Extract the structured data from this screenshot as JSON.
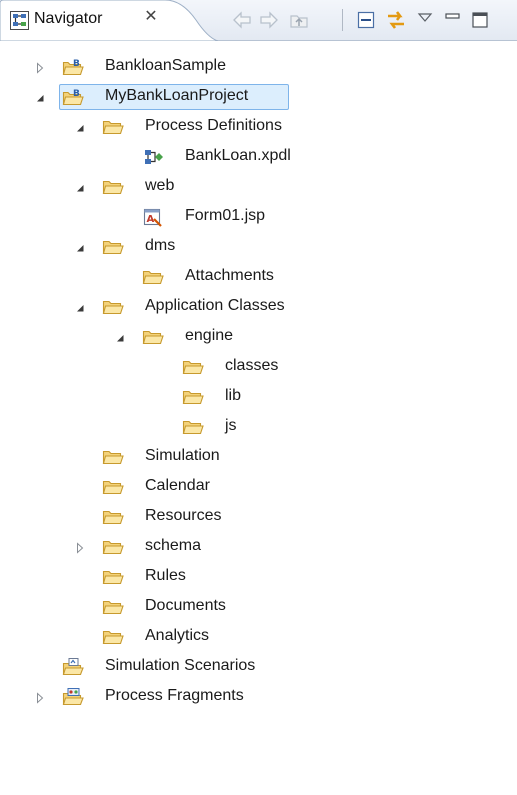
{
  "view": {
    "title": "Navigator",
    "close_glyph": "✕",
    "title_icon": "navigator-view-icon"
  },
  "toolbar": {
    "buttons": [
      {
        "name": "back-button",
        "icon": "arrow-left-icon"
      },
      {
        "name": "forward-button",
        "icon": "arrow-right-icon"
      },
      {
        "name": "up-button",
        "icon": "go-up-icon"
      },
      {
        "name": "collapse-all-button",
        "icon": "collapse-all-icon"
      },
      {
        "name": "link-with-editor-button",
        "icon": "link-icon"
      },
      {
        "name": "view-menu-button",
        "icon": "triangle-down-icon"
      },
      {
        "name": "minimize-button",
        "icon": "minimize-icon"
      },
      {
        "name": "maximize-button",
        "icon": "maximize-icon"
      }
    ]
  },
  "tree": {
    "items": [
      {
        "label": "BankloanSample",
        "icon": "project-icon",
        "state": "collapsed",
        "depth": 0
      },
      {
        "label": "MyBankLoanProject",
        "icon": "project-icon",
        "state": "expanded",
        "depth": 0,
        "selected": true
      },
      {
        "label": "Process Definitions",
        "icon": "folder-icon",
        "state": "expanded",
        "depth": 1
      },
      {
        "label": "BankLoan.xpdl",
        "icon": "xpdl-file-icon",
        "state": "leaf",
        "depth": 2
      },
      {
        "label": "web",
        "icon": "folder-icon",
        "state": "expanded",
        "depth": 1
      },
      {
        "label": "Form01.jsp",
        "icon": "jsp-file-icon",
        "state": "leaf",
        "depth": 2
      },
      {
        "label": "dms",
        "icon": "folder-icon",
        "state": "expanded",
        "depth": 1
      },
      {
        "label": "Attachments",
        "icon": "folder-icon",
        "state": "leaf",
        "depth": 2
      },
      {
        "label": "Application Classes",
        "icon": "folder-icon",
        "state": "expanded",
        "depth": 1
      },
      {
        "label": "engine",
        "icon": "folder-icon",
        "state": "expanded",
        "depth": 2
      },
      {
        "label": "classes",
        "icon": "folder-icon",
        "state": "leaf",
        "depth": 3
      },
      {
        "label": "lib",
        "icon": "folder-icon",
        "state": "leaf",
        "depth": 3
      },
      {
        "label": "js",
        "icon": "folder-icon",
        "state": "leaf",
        "depth": 3
      },
      {
        "label": "Simulation",
        "icon": "folder-icon",
        "state": "leaf",
        "depth": 1
      },
      {
        "label": "Calendar",
        "icon": "folder-icon",
        "state": "leaf",
        "depth": 1
      },
      {
        "label": "Resources",
        "icon": "folder-icon",
        "state": "leaf",
        "depth": 1
      },
      {
        "label": "schema",
        "icon": "folder-icon",
        "state": "collapsed",
        "depth": 1
      },
      {
        "label": "Rules",
        "icon": "folder-icon",
        "state": "leaf",
        "depth": 1
      },
      {
        "label": "Documents",
        "icon": "folder-icon",
        "state": "leaf",
        "depth": 1
      },
      {
        "label": "Analytics",
        "icon": "folder-icon",
        "state": "leaf",
        "depth": 1
      },
      {
        "label": "Simulation Scenarios",
        "icon": "simulation-project-icon",
        "state": "leaf",
        "depth": 0
      },
      {
        "label": "Process Fragments",
        "icon": "fragments-project-icon",
        "state": "collapsed",
        "depth": 0
      }
    ]
  },
  "colors": {
    "folder": "#f3d27a",
    "folder_stroke": "#c79a2e",
    "selection": "#dceefd",
    "selection_border": "#7eb4ea"
  }
}
